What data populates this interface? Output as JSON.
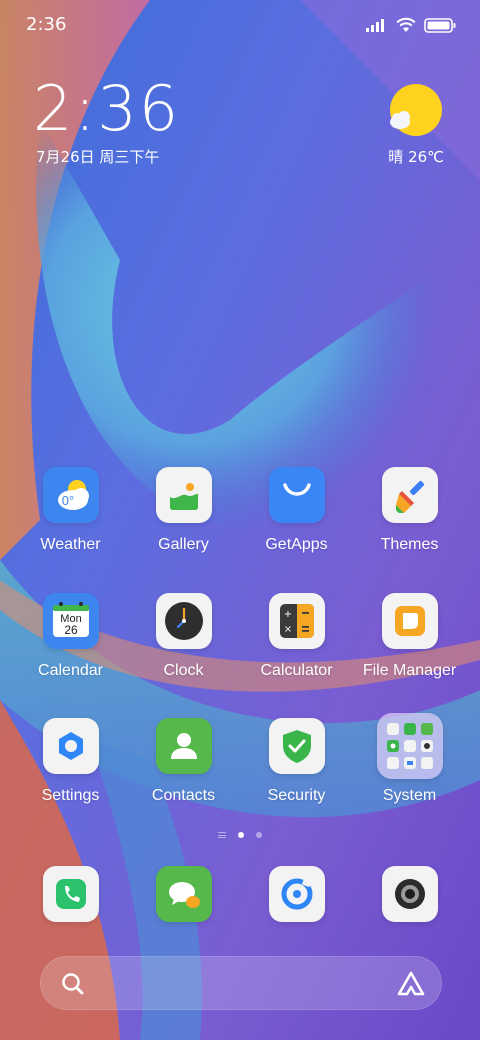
{
  "status_bar": {
    "time": "2:36"
  },
  "clock_widget": {
    "time": "2:36",
    "date": "7月26日 周三下午"
  },
  "weather_widget": {
    "condition_temp": "晴 26℃",
    "icon": "sun-icon"
  },
  "apps": [
    {
      "label": "Weather",
      "icon": "weather-icon",
      "badge": "0°"
    },
    {
      "label": "Gallery",
      "icon": "gallery-icon"
    },
    {
      "label": "GetApps",
      "icon": "getapps-icon"
    },
    {
      "label": "Themes",
      "icon": "themes-icon"
    },
    {
      "label": "Calendar",
      "icon": "calendar-icon",
      "day_name": "Mon",
      "day_number": "26"
    },
    {
      "label": "Clock",
      "icon": "clock-icon"
    },
    {
      "label": "Calculator",
      "icon": "calculator-icon"
    },
    {
      "label": "File Manager",
      "icon": "file-manager-icon"
    },
    {
      "label": "Settings",
      "icon": "settings-icon"
    },
    {
      "label": "Contacts",
      "icon": "contacts-icon"
    },
    {
      "label": "Security",
      "icon": "security-icon"
    },
    {
      "label": "System",
      "icon": "system-folder-icon"
    }
  ],
  "page_indicator": {
    "pages": 2,
    "current": 1
  },
  "dock": [
    {
      "icon": "phone-icon"
    },
    {
      "icon": "messages-icon"
    },
    {
      "icon": "browser-icon"
    },
    {
      "icon": "camera-icon"
    }
  ],
  "search_bar": {
    "search_icon": "search-icon",
    "assistant_icon": "assistant-icon"
  },
  "colors": {
    "weather_blue": "#3d86f0",
    "gallery_bg": "#f3f3f3",
    "getapps_blue": "#3b86f5",
    "security_green": "#3ab54a",
    "contacts_green": "#56b84a",
    "phone_green": "#2bc26b",
    "sun_yellow": "#ffd21f"
  }
}
